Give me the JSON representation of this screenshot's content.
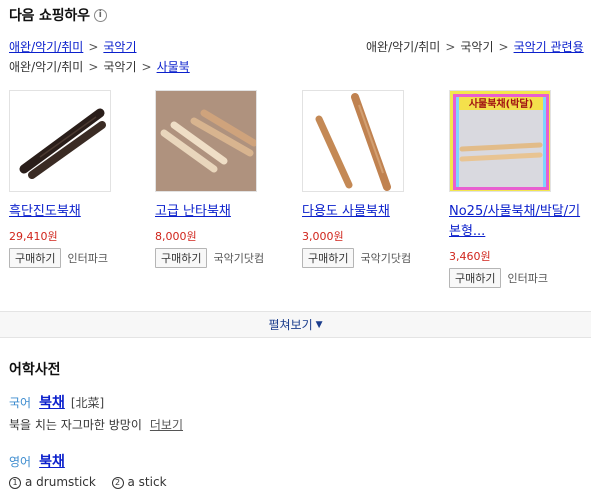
{
  "shopping": {
    "title": "다음 쇼핑하우",
    "info_icon": "i",
    "breadcrumb_left": [
      "애완/악기/취미",
      "국악기"
    ],
    "breadcrumb_right": [
      "애완/악기/취미",
      "국악기",
      "국악기 관련용"
    ],
    "breadcrumb_second": [
      "애완/악기/취미",
      "국악기",
      "사물북"
    ],
    "separator": ">",
    "buy_label": "구매하기",
    "expand_label": "펼쳐보기",
    "products": [
      {
        "name": "흑단진도북채",
        "price": "29,410원",
        "seller": "인터파크"
      },
      {
        "name": "고급 난타북채",
        "price": "8,000원",
        "seller": "국악기닷컴"
      },
      {
        "name": "다용도 사물북채",
        "price": "3,000원",
        "seller": "국악기닷컴"
      },
      {
        "name": "No25/사물북채/박달/기본형...",
        "price": "3,460원",
        "seller": "인터파크"
      }
    ],
    "product4_image_text": "사물북채(박달)"
  },
  "dictionary": {
    "title": "어학사전",
    "kor": {
      "tag": "국어",
      "word": "북채",
      "hanja": "[北菜]",
      "definition": "북을 치는 자그마한 방망이",
      "more": "더보기"
    },
    "eng": {
      "tag": "영어",
      "word": "북채",
      "meanings": [
        {
          "num": "1",
          "text": "a drumstick"
        },
        {
          "num": "2",
          "text": "a stick"
        }
      ]
    }
  }
}
